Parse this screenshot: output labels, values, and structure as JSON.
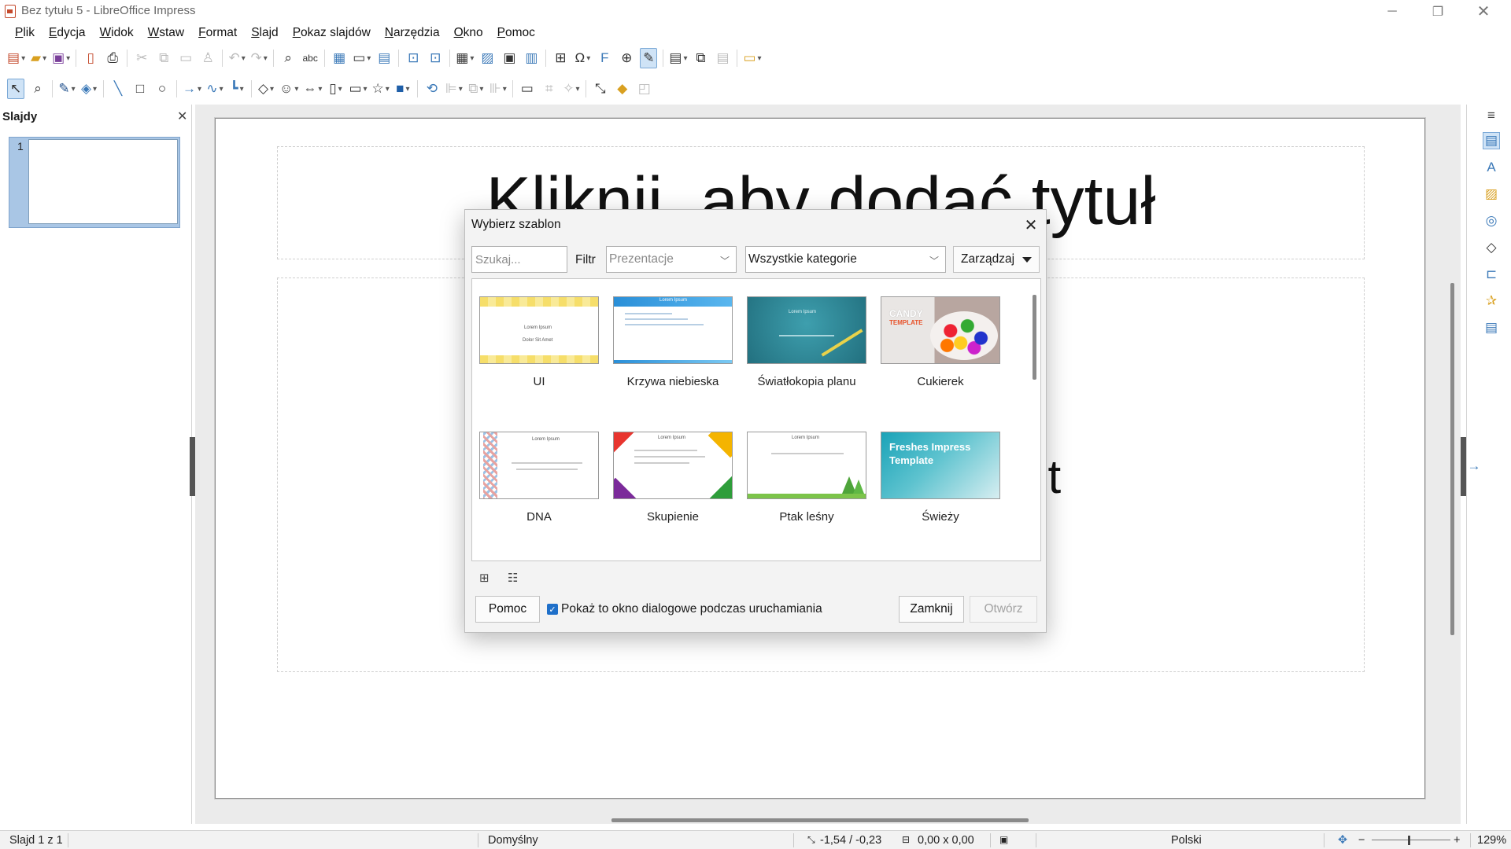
{
  "window": {
    "title": "Bez tytułu 5 - LibreOffice Impress"
  },
  "menu": [
    "Plik",
    "Edycja",
    "Widok",
    "Wstaw",
    "Format",
    "Slajd",
    "Pokaz slajdów",
    "Narzędzia",
    "Okno",
    "Pomoc"
  ],
  "slides_pane": {
    "title": "Slajdy",
    "slide_number": "1"
  },
  "slide": {
    "title_placeholder": "Kliknij, aby dodać tytuł",
    "content_placeholder": "Kliknij, aby dodać tekst"
  },
  "dialog": {
    "title": "Wybierz szablon",
    "search_placeholder": "Szukaj...",
    "filter_label": "Filtr",
    "filter_value": "Prezentacje",
    "category_value": "Wszystkie kategorie",
    "manage_label": "Zarządzaj",
    "templates": [
      {
        "name": "UI"
      },
      {
        "name": "Krzywa niebieska"
      },
      {
        "name": "Światłokopia planu"
      },
      {
        "name": "Cukierek"
      },
      {
        "name": "DNA"
      },
      {
        "name": "Skupienie"
      },
      {
        "name": "Ptak leśny"
      },
      {
        "name": "Świeży"
      }
    ],
    "thumb_text": {
      "lorem": "Lorem Ipsum",
      "dolor": "Dolor Sit Amet",
      "candy": "CANDY",
      "candy_sub": "TEMPLATE",
      "freshes": "Freshes Impress Template"
    },
    "help_label": "Pomoc",
    "startup_checkbox_label": "Pokaż to okno dialogowe podczas uruchamiania",
    "startup_checked": true,
    "close_label": "Zamknij",
    "open_label": "Otwórz"
  },
  "status": {
    "slide_info": "Slajd 1 z 1",
    "master": "Domyślny",
    "position": "-1,54 / -0,23",
    "size": "0,00 x 0,00",
    "language": "Polski",
    "zoom": "129%"
  },
  "colors": {
    "accent": "#1e6fc9",
    "workspace": "#ebebeb",
    "selection": "#a9c6e5"
  }
}
